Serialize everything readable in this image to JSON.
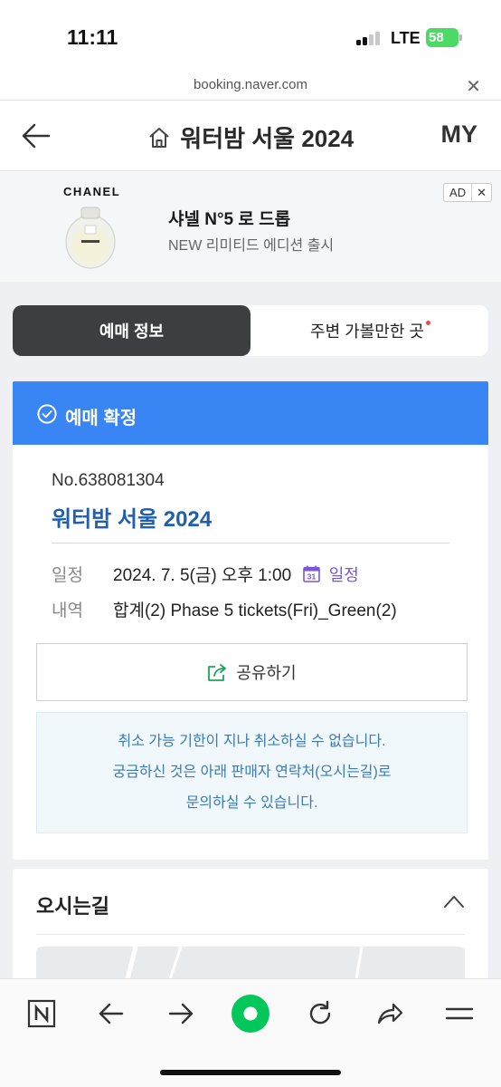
{
  "status_bar": {
    "time": "11:11",
    "network": "LTE",
    "battery": "58"
  },
  "url_bar": {
    "url": "booking.naver.com",
    "close_glyph": "✕"
  },
  "header": {
    "title": "워터밤 서울 2024",
    "my_label": "MY",
    "back_icon": "arrow-left-icon",
    "home_icon": "home-icon"
  },
  "ad": {
    "brand": "CHANEL",
    "headline": "샤넬 N°5 로 드롭",
    "subtext": "NEW 리미티드 에디션 출시",
    "badge_label": "AD",
    "badge_close": "✕"
  },
  "tabs": [
    {
      "label": "예매 정보",
      "active": true
    },
    {
      "label": "주변 가볼만한 곳",
      "active": false,
      "new_dot": true
    }
  ],
  "booking": {
    "status_label": "예매 확정",
    "number": "No.638081304",
    "event_name": "워터밤 서울 2024",
    "schedule_label": "일정",
    "schedule_value": "2024. 7. 5(금) 오후 1:00",
    "calendar_day": "31",
    "calendar_link": "일정",
    "details_label": "내역",
    "details_value": "합계(2) Phase 5 tickets(Fri)_Green(2)",
    "share_label": "공유하기",
    "notice_lines": [
      "취소 가능 기한이 지나 취소하실 수 없습니다.",
      "궁금하신 것은 아래 판매자 연락처(오시는길)로",
      "문의하실 수 있습니다."
    ]
  },
  "directions": {
    "title": "오시는길"
  },
  "colors": {
    "accent_blue": "#3a85f4",
    "event_blue": "#1f5fae",
    "active_tab": "#3d3e42",
    "naver_green": "#03c75a",
    "calendar_purple": "#7b56d8",
    "notice_text": "#3b7bb6"
  },
  "toolbar": [
    "naver-n-icon",
    "back-arrow-icon",
    "forward-arrow-icon",
    "green-home-circle-icon",
    "refresh-icon",
    "share-arrow-icon",
    "menu-icon"
  ]
}
